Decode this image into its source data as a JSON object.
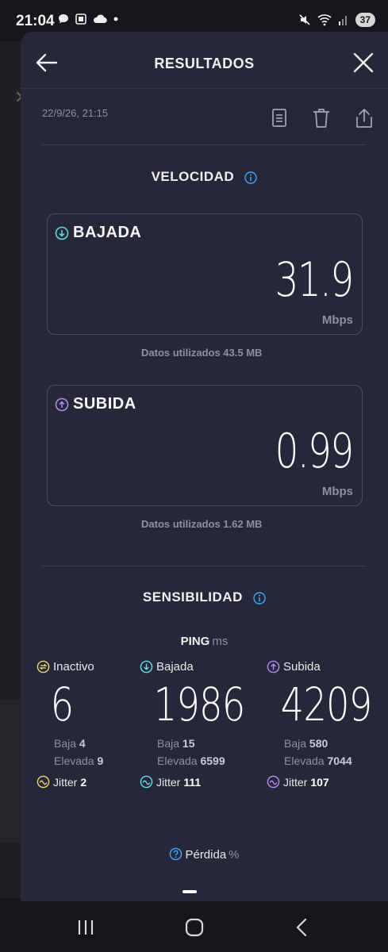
{
  "status_bar": {
    "time": "21:04",
    "battery": "37",
    "left_icons": [
      "chat-bubble-icon",
      "screenshot-icon",
      "cloud-icon",
      "dot-icon"
    ],
    "right_icons": [
      "mute-icon",
      "wifi-icon",
      "signal-icon"
    ]
  },
  "header": {
    "title": "RESULTADOS",
    "back_icon": "arrow-left-icon",
    "close_icon": "close-icon"
  },
  "meta": {
    "date": "22/9/26, 21:15",
    "actions": [
      "document-icon",
      "trash-icon",
      "share-icon"
    ]
  },
  "velocidad": {
    "title": "VELOCIDAD",
    "download": {
      "label": "BAJADA",
      "value": "31.9",
      "unit": "Mbps",
      "data_used": "Datos utilizados 43.5 MB",
      "color": "#5ee0e8"
    },
    "upload": {
      "label": "SUBIDA",
      "value": "0.99",
      "unit": "Mbps",
      "data_used": "Datos utilizados 1.62 MB",
      "color": "#b28cf0"
    }
  },
  "sensibilidad": {
    "title": "SENSIBILIDAD",
    "ping_label": "PING",
    "ping_unit": "ms",
    "columns": [
      {
        "label": "Inactivo",
        "value": "6",
        "low_label": "Baja",
        "low": "4",
        "high_label": "Elevada",
        "high": "9",
        "jitter_label": "Jitter",
        "jitter": "2",
        "color": "#f2d56b"
      },
      {
        "label": "Bajada",
        "value": "1986",
        "low_label": "Baja",
        "low": "15",
        "high_label": "Elevada",
        "high": "6599",
        "jitter_label": "Jitter",
        "jitter": "111",
        "color": "#5ee0e8"
      },
      {
        "label": "Subida",
        "value": "4209",
        "low_label": "Baja",
        "low": "580",
        "high_label": "Elevada",
        "high": "7044",
        "jitter_label": "Jitter",
        "jitter": "107",
        "color": "#b28cf0"
      }
    ],
    "loss_label": "Pérdida",
    "loss_unit": "%"
  },
  "accent_info_color": "#3aa8ff"
}
